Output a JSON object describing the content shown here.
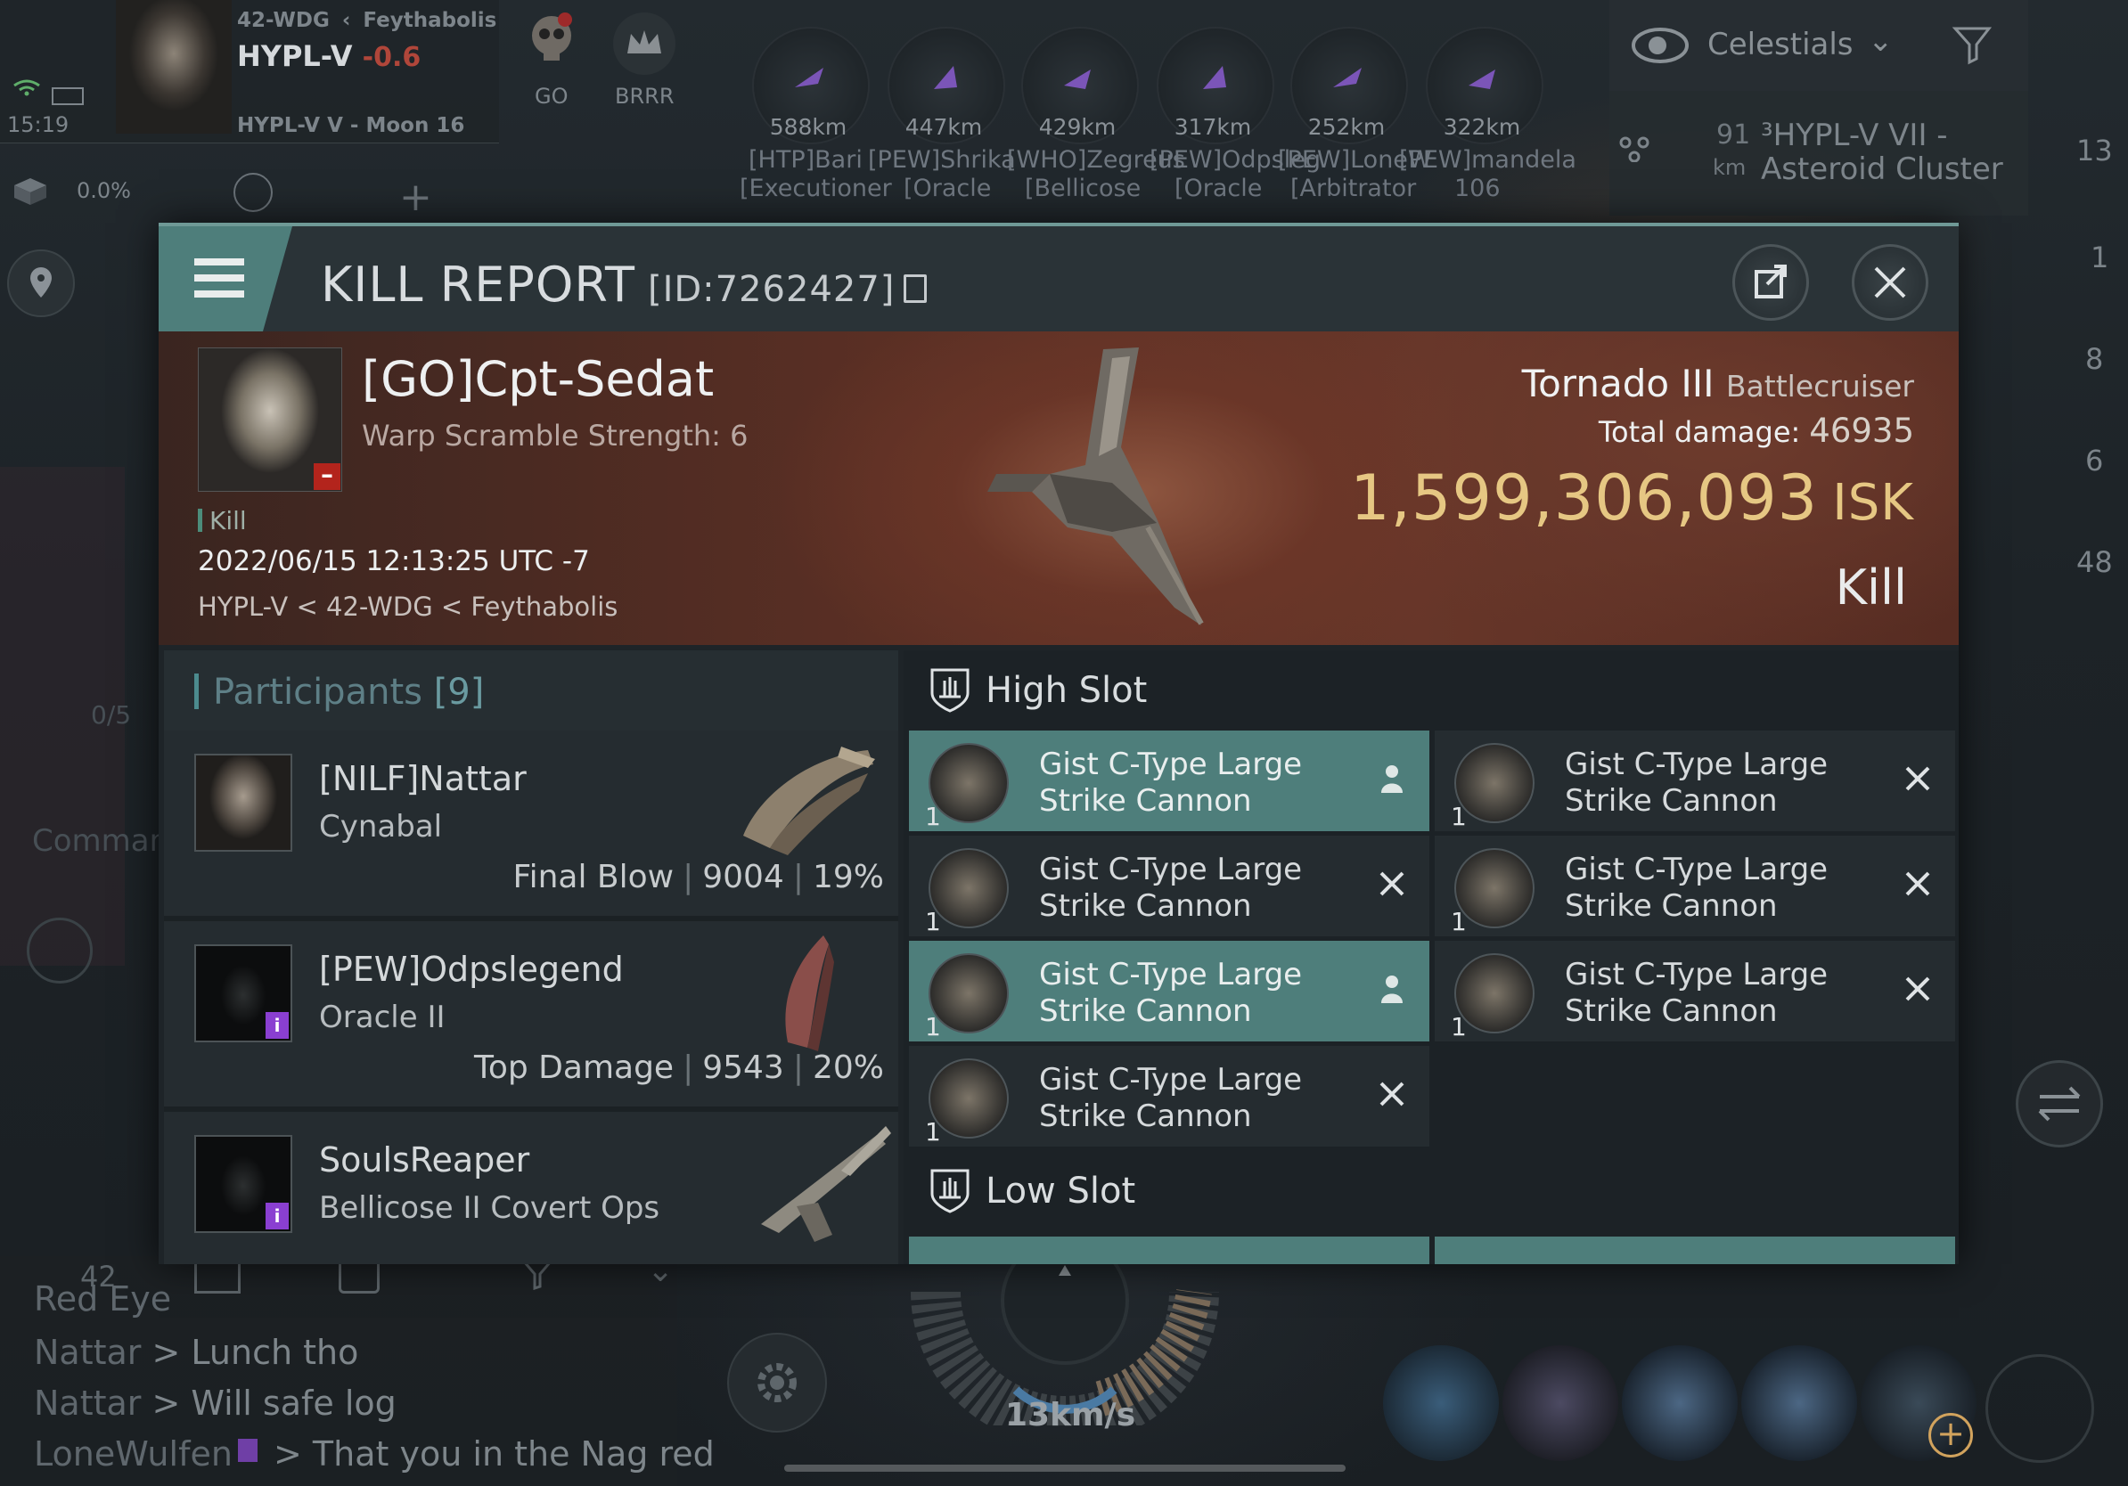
{
  "hud": {
    "time": "15:19",
    "region_path": "42-WDG",
    "constellation": "Feythabolis",
    "system": "HYPL-V",
    "security": "-0.6",
    "location": "HYPL-V V - Moon 16",
    "cargo_pct": "0.0%",
    "fleet_tags": [
      "GO",
      "BRRR"
    ],
    "overview": [
      {
        "dist": "588km",
        "name": "[HTP]Bari",
        "ship": "[Executioner"
      },
      {
        "dist": "447km",
        "name": "[PEW]Shrika",
        "ship": "[Oracle"
      },
      {
        "dist": "429km",
        "name": "[WHO]Zegreus",
        "ship": "[Bellicose"
      },
      {
        "dist": "317km",
        "name": "[PEW]Odpsleg",
        "ship": "[Oracle"
      },
      {
        "dist": "252km",
        "name": "[PEW]LoneW",
        "ship": "[Arbitrator"
      },
      {
        "dist": "322km",
        "name": "[PEW]mandela",
        "ship": "106"
      }
    ],
    "celestials_label": "Celestials",
    "nav_distance": "91",
    "nav_unit": "km",
    "nav_target": "³HYPL-V VII -",
    "nav_target2": "Asteroid Cluster",
    "right_counts": [
      "13",
      "1",
      "8",
      "6",
      "48"
    ],
    "speed": "13km/s",
    "chat": [
      {
        "name": "Red Eye",
        "text": ""
      },
      {
        "name": "Nattar",
        "text": " > Lunch tho"
      },
      {
        "name": "Nattar",
        "text": " > Will safe log"
      },
      {
        "name": "LoneWulfen",
        "text": " > That you in the Nag red"
      }
    ],
    "command_label": "Command",
    "counter_label": "0/5",
    "chat_count": "42"
  },
  "report": {
    "title": "KILL REPORT",
    "id": "[ID:7262427]",
    "victim": {
      "name": "[GO]Cpt-Sedat",
      "warp_scramble": "Warp Scramble Strength: 6",
      "kill_tag": "Kill",
      "date": "2022/06/15 12:13:25 UTC -7",
      "location": "HYPL-V < 42-WDG < Feythabolis",
      "ship": "Tornado III",
      "ship_class": "Battlecruiser",
      "damage_label": "Total damage:",
      "damage": "46935",
      "isk": "1,599,306,093",
      "isk_unit": "ISK",
      "result": "Kill"
    },
    "participants_title": "Participants",
    "participants_count": "[9]",
    "participants": [
      {
        "name": "[NILF]Nattar",
        "ship": "Cynabal",
        "tag": "Final Blow",
        "damage": "9004",
        "pct": "19%"
      },
      {
        "name": "[PEW]Odpslegend",
        "ship": "Oracle II",
        "tag": "Top Damage",
        "damage": "9543",
        "pct": "20%"
      },
      {
        "name": "SoulsReaper",
        "ship": "Bellicose II Covert Ops",
        "tag": "",
        "damage": "",
        "pct": ""
      }
    ],
    "high_slot_title": "High Slot",
    "low_slot_title": "Low Slot",
    "modules": [
      {
        "line1": "Gist C-Type Large",
        "line2": "Strike Cannon",
        "qty": "1",
        "state": "dropped"
      },
      {
        "line1": "Gist C-Type Large",
        "line2": "Strike Cannon",
        "qty": "1",
        "state": "destroyed"
      },
      {
        "line1": "Gist C-Type Large",
        "line2": "Strike Cannon",
        "qty": "1",
        "state": "destroyed"
      },
      {
        "line1": "Gist C-Type Large",
        "line2": "Strike Cannon",
        "qty": "1",
        "state": "destroyed"
      },
      {
        "line1": "Gist C-Type Large",
        "line2": "Strike Cannon",
        "qty": "1",
        "state": "dropped"
      },
      {
        "line1": "Gist C-Type Large",
        "line2": "Strike Cannon",
        "qty": "1",
        "state": "destroyed"
      },
      {
        "line1": "Gist C-Type Large",
        "line2": "Strike Cannon",
        "qty": "1",
        "state": "destroyed"
      }
    ]
  }
}
